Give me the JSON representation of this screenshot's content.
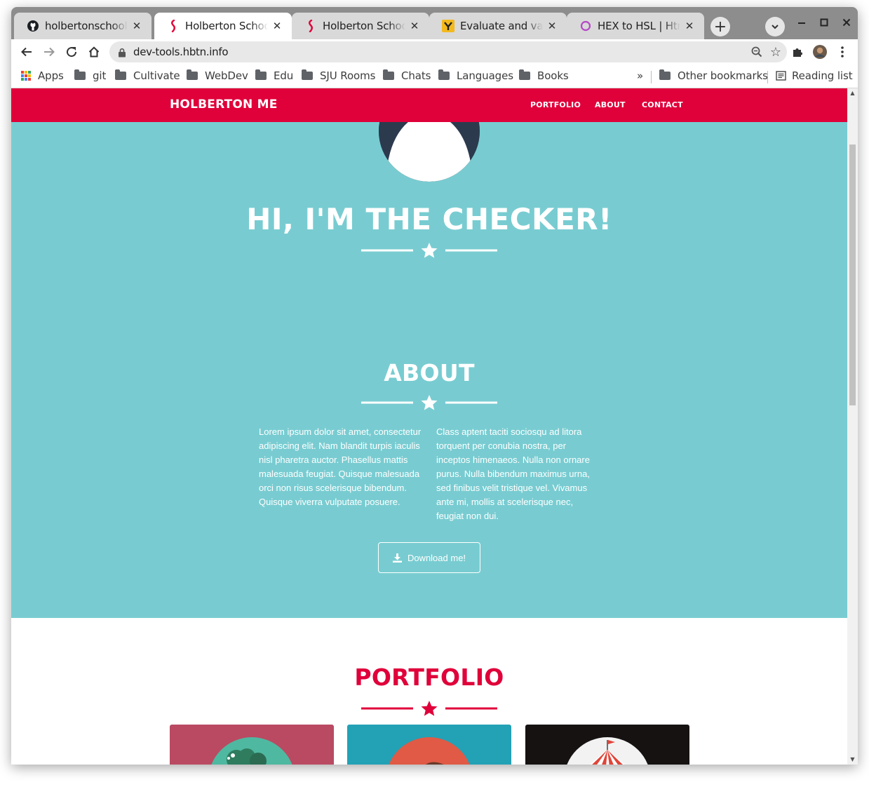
{
  "browser": {
    "tabs": [
      {
        "title": "holbertonschool-w",
        "favicon": "github-icon",
        "active": false
      },
      {
        "title": "Holberton School - ",
        "favicon": "holberton-icon",
        "active": true
      },
      {
        "title": "Holberton School - ",
        "favicon": "holberton-icon",
        "active": false
      },
      {
        "title": "Evaluate and valida",
        "favicon": "yapi-icon",
        "active": false
      },
      {
        "title": "HEX to HSL | Html C",
        "favicon": "circle-icon",
        "active": false
      }
    ],
    "new_tab_label": "+",
    "url": "dev-tools.hbtn.info",
    "bookmarks": [
      {
        "label": "Apps",
        "icon": "apps-grid-icon"
      },
      {
        "label": "git",
        "icon": "folder-icon"
      },
      {
        "label": "Cultivate",
        "icon": "folder-icon"
      },
      {
        "label": "WebDev",
        "icon": "folder-icon"
      },
      {
        "label": "Edu",
        "icon": "folder-icon"
      },
      {
        "label": "SJU Rooms",
        "icon": "folder-icon"
      },
      {
        "label": "Chats",
        "icon": "folder-icon"
      },
      {
        "label": "Languages",
        "icon": "folder-icon"
      },
      {
        "label": "Books",
        "icon": "folder-icon"
      }
    ],
    "bookmarks_overflow": "»",
    "other_bookmarks": "Other bookmarks",
    "reading_list": "Reading list"
  },
  "page": {
    "brand": "HOLBERTON ME",
    "nav": [
      "PORTFOLIO",
      "ABOUT",
      "CONTACT"
    ],
    "hero_title": "HI, I'M THE CHECKER!",
    "about_title": "ABOUT",
    "about_col1": "Lorem ipsum dolor sit amet, consectetur adipiscing elit. Nam blandit turpis iaculis nisl pharetra auctor. Phasellus mattis malesuada feugiat. Quisque malesuada orci non risus scelerisque bibendum. Quisque viverra vulputate posuere.",
    "about_col2": "Class aptent taciti sociosqu ad litora torquent per conubia nostra, per inceptos himenaeos. Nulla non ornare purus. Nulla bibendum maximus urna, sed finibus velit tristique vel. Vivamus ante mi, mollis at scelerisque nec, feugiat non dui.",
    "download_label": "Download me!",
    "portfolio_title": "PORTFOLIO"
  },
  "colors": {
    "navbar": "#e0003a",
    "hero_bg": "#78ccd1",
    "accent": "#e0003a",
    "card1": "#b94a62",
    "card2": "#23a1b5",
    "card3": "#161212"
  }
}
